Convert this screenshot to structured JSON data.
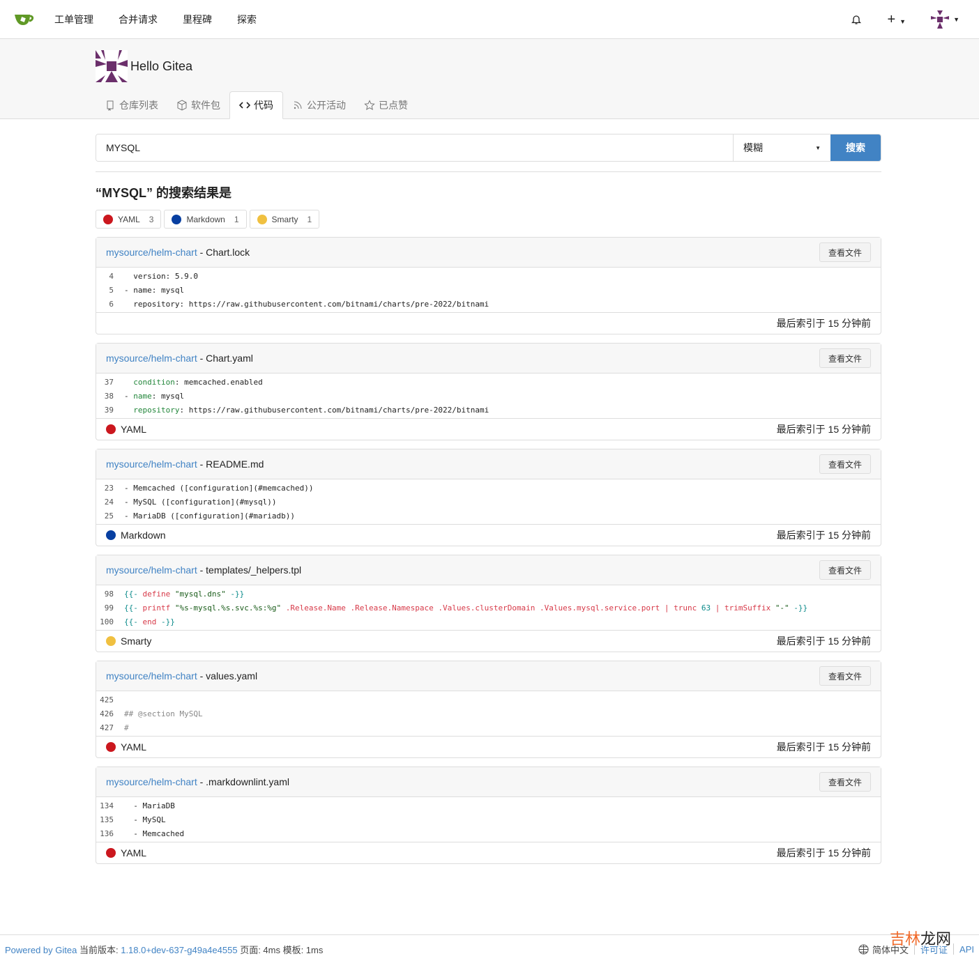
{
  "nav": {
    "items": [
      "工单管理",
      "合并请求",
      "里程碑",
      "探索"
    ],
    "brand_color": "#609926"
  },
  "org": {
    "name": "Hello Gitea"
  },
  "tabs": [
    {
      "label": "仓库列表",
      "icon": "repo-icon"
    },
    {
      "label": "软件包",
      "icon": "package-icon"
    },
    {
      "label": "代码",
      "icon": "code-icon",
      "active": true
    },
    {
      "label": "公开活动",
      "icon": "rss-icon"
    },
    {
      "label": "已点赞",
      "icon": "star-icon"
    }
  ],
  "search": {
    "value": "MYSQL",
    "mode": "模糊",
    "button": "搜索"
  },
  "results_title": "“MYSQL” 的搜索结果是",
  "languages": [
    {
      "name": "YAML",
      "count": "3",
      "color": "#cb171e"
    },
    {
      "name": "Markdown",
      "count": "1",
      "color": "#083fa1"
    },
    {
      "name": "Smarty",
      "count": "1",
      "color": "#f0c040"
    }
  ],
  "view_label": "查看文件",
  "results": [
    {
      "repo": "mysource/helm-chart",
      "file": "Chart.lock",
      "language": "",
      "color": "",
      "indexed": "最后索引于 15 分钟前",
      "lines": [
        {
          "n": "4",
          "t": [
            [
              "  version: 5.9.0",
              ""
            ]
          ]
        },
        {
          "n": "5",
          "t": [
            [
              "- name: mysql",
              ""
            ]
          ]
        },
        {
          "n": "6",
          "t": [
            [
              "  repository: https://raw.githubusercontent.com/bitnami/charts/pre-2022/bitnami",
              ""
            ]
          ]
        }
      ]
    },
    {
      "repo": "mysource/helm-chart",
      "file": "Chart.yaml",
      "language": "YAML",
      "color": "#cb171e",
      "indexed": "最后索引于 15 分钟前",
      "lines": [
        {
          "n": "37",
          "t": [
            [
              "  ",
              ""
            ],
            [
              "condition",
              "key"
            ],
            [
              ": memcached.enabled",
              ""
            ]
          ]
        },
        {
          "n": "38",
          "t": [
            [
              "- ",
              ""
            ],
            [
              "name",
              "key"
            ],
            [
              ": mysql",
              ""
            ]
          ]
        },
        {
          "n": "39",
          "t": [
            [
              "  ",
              ""
            ],
            [
              "repository",
              "key"
            ],
            [
              ": https://raw.githubusercontent.com/bitnami/charts/pre-2022/bitnami",
              ""
            ]
          ]
        }
      ]
    },
    {
      "repo": "mysource/helm-chart",
      "file": "README.md",
      "language": "Markdown",
      "color": "#083fa1",
      "indexed": "最后索引于 15 分钟前",
      "lines": [
        {
          "n": "23",
          "t": [
            [
              "- Memcached ([configuration](#memcached))",
              ""
            ]
          ]
        },
        {
          "n": "24",
          "t": [
            [
              "- MySQL ([configuration](#mysql))",
              ""
            ]
          ]
        },
        {
          "n": "25",
          "t": [
            [
              "- MariaDB ([configuration](#mariadb))",
              ""
            ]
          ]
        }
      ]
    },
    {
      "repo": "mysource/helm-chart",
      "file": "templates/_helpers.tpl",
      "language": "Smarty",
      "color": "#f0c040",
      "indexed": "最后索引于 15 分钟前",
      "lines": [
        {
          "n": "98",
          "t": [
            [
              "{{-",
              "p"
            ],
            [
              " define ",
              "kw"
            ],
            [
              "\"mysql.dns\"",
              "str"
            ],
            [
              " -}}",
              "p"
            ]
          ]
        },
        {
          "n": "99",
          "t": [
            [
              "{{-",
              "p"
            ],
            [
              " printf ",
              "kw"
            ],
            [
              "\"%s-mysql.%s.svc.%s:%g\"",
              "str"
            ],
            [
              " .Release.Name .Release.Namespace .Values.clusterDomain .Values.mysql.service.port | trunc ",
              "kw"
            ],
            [
              "63",
              "num"
            ],
            [
              " | trimSuffix ",
              "kw"
            ],
            [
              "\"-\"",
              "str"
            ],
            [
              " -}}",
              "p"
            ]
          ]
        },
        {
          "n": "100",
          "t": [
            [
              "{{-",
              "p"
            ],
            [
              " end ",
              "kw"
            ],
            [
              "-}}",
              "p"
            ]
          ]
        }
      ]
    },
    {
      "repo": "mysource/helm-chart",
      "file": "values.yaml",
      "language": "YAML",
      "color": "#cb171e",
      "indexed": "最后索引于 15 分钟前",
      "lines": [
        {
          "n": "425",
          "t": [
            [
              "",
              ""
            ]
          ]
        },
        {
          "n": "426",
          "t": [
            [
              "## @section MySQL",
              "c"
            ]
          ]
        },
        {
          "n": "427",
          "t": [
            [
              "#",
              "c"
            ]
          ]
        }
      ]
    },
    {
      "repo": "mysource/helm-chart",
      "file": ".markdownlint.yaml",
      "language": "YAML",
      "color": "#cb171e",
      "indexed": "最后索引于 15 分钟前",
      "lines": [
        {
          "n": "134",
          "t": [
            [
              "  - MariaDB",
              ""
            ]
          ]
        },
        {
          "n": "135",
          "t": [
            [
              "  - MySQL",
              ""
            ]
          ]
        },
        {
          "n": "136",
          "t": [
            [
              "  - Memcached",
              ""
            ]
          ]
        }
      ]
    }
  ],
  "footer": {
    "powered": "Powered by Gitea",
    "version_label": "当前版本:",
    "version": "1.18.0+dev-637-g49a4e4555",
    "page": "页面: 4ms 模板: 1ms",
    "language": "简体中文",
    "license": "许可证",
    "api": "API"
  },
  "watermark": "吉林龙网"
}
